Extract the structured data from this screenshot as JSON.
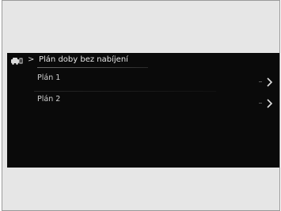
{
  "header": {
    "back_glyph": ">",
    "title": "Plán doby bez nabíjení",
    "icon": "car-charging-icon"
  },
  "plans": [
    {
      "label": "Plán 1",
      "icon": "chevron-right-icon"
    },
    {
      "label": "Plán 2",
      "icon": "chevron-right-icon"
    }
  ],
  "colors": {
    "screen_bg": "#0a0a0a",
    "frame_bg": "#e6e6e6",
    "text": "#e6e6e6",
    "row_text": "#cfcfcf"
  }
}
